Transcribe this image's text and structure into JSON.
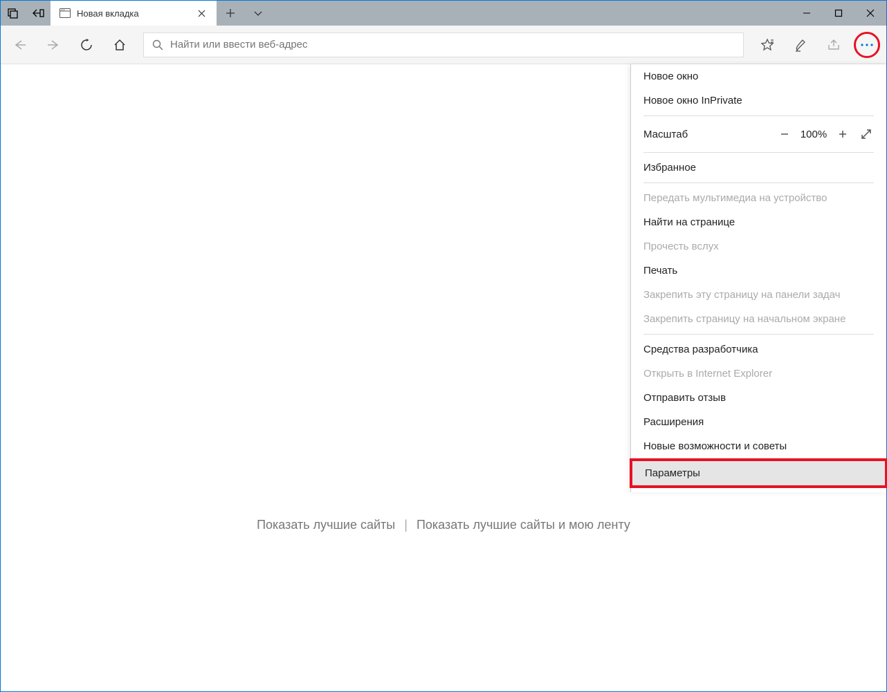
{
  "tab": {
    "title": "Новая вкладка"
  },
  "addressbar": {
    "placeholder": "Найти или ввести веб-адрес"
  },
  "ntp": {
    "link1": "Показать лучшие сайты",
    "sep": "|",
    "link2": "Показать лучшие сайты и мою ленту"
  },
  "menu": {
    "new_window": "Новое окно",
    "new_inprivate": "Новое окно InPrivate",
    "zoom_label": "Масштаб",
    "zoom_value": "100%",
    "favorites": "Избранное",
    "cast": "Передать мультимедиа на устройство",
    "find": "Найти на странице",
    "read_aloud": "Прочесть вслух",
    "print": "Печать",
    "pin_taskbar": "Закрепить эту страницу на панели задач",
    "pin_start": "Закрепить страницу на начальном экране",
    "devtools": "Средства разработчика",
    "open_ie": "Открыть в Internet Explorer",
    "feedback": "Отправить отзыв",
    "extensions": "Расширения",
    "whats_new": "Новые возможности и советы",
    "settings": "Параметры"
  }
}
